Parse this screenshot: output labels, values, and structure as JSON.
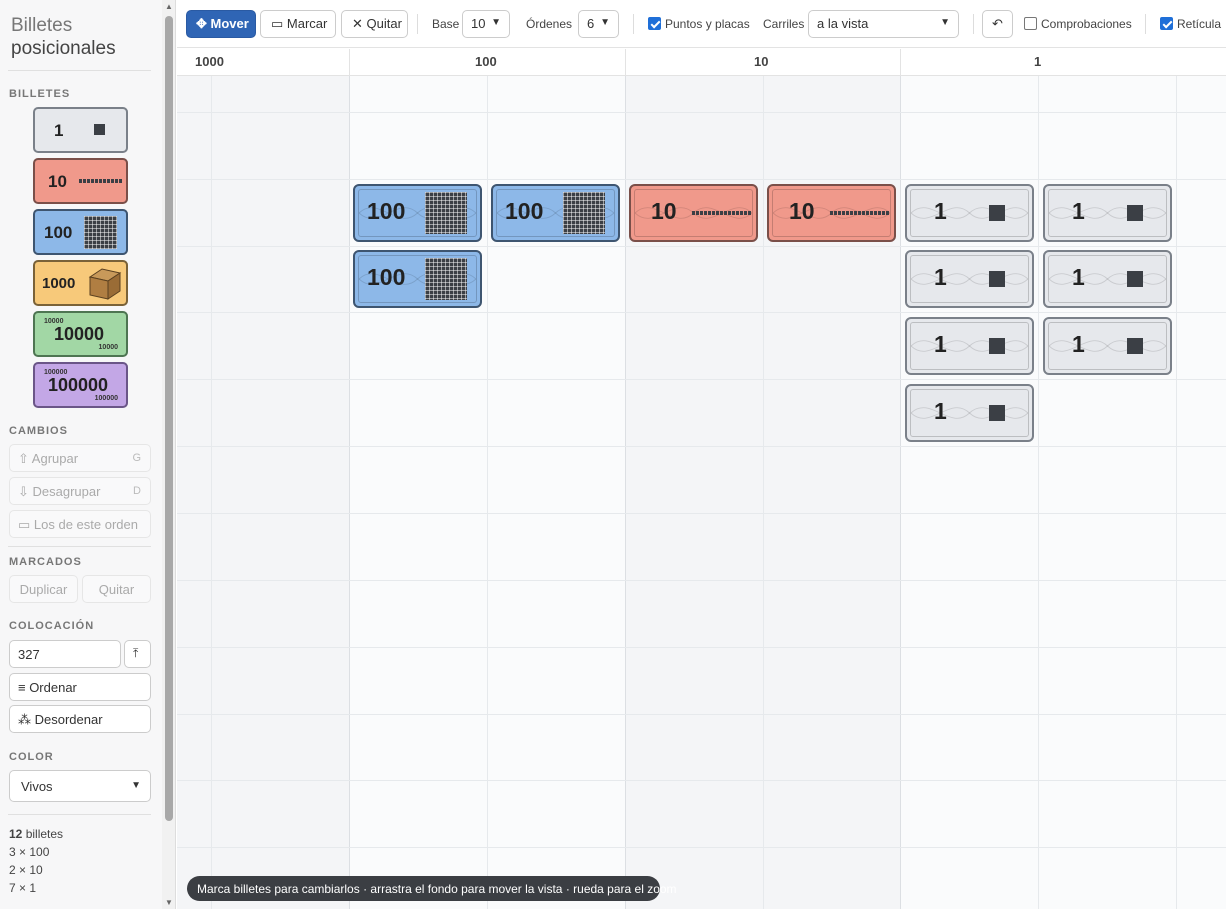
{
  "sidebar": {
    "title_line1": "Billetes",
    "title_line2": "posicionales",
    "sections": {
      "billetes": "BILLETES",
      "cambios": "CAMBIOS",
      "marcados": "MARCADOS",
      "colocacion": "COLOCACIÓN",
      "color": "COLOR"
    },
    "palette": [
      {
        "label": "1",
        "color": "#e6e8ec"
      },
      {
        "label": "10",
        "color": "#f0998b"
      },
      {
        "label": "100",
        "color": "#8db8e8"
      },
      {
        "label": "1000",
        "color": "#f7c97a"
      },
      {
        "label": "10000",
        "color": "#a2d7a5"
      },
      {
        "label": "100000",
        "color": "#c3a7e6"
      }
    ],
    "cambios": {
      "agrupar": "⇧ Agrupar",
      "agrupar_key": "G",
      "desagrupar": "⇩ Desagrupar",
      "desagrupar_key": "D",
      "orden": "▭ Los de este orden"
    },
    "marcados": {
      "duplicar": "Duplicar",
      "quitar": "Quitar"
    },
    "colocacion": {
      "value": "327",
      "ordenar": "≡ Ordenar",
      "desordenar": "⁂ Desordenar"
    },
    "color": {
      "selected": "Vivos"
    },
    "summary": {
      "count": "12",
      "count_label": " billetes",
      "lines": [
        "3 × 100",
        "2 × 10",
        "7 × 1"
      ]
    }
  },
  "toolbar": {
    "mover": "✥ Mover",
    "marcar": "▭ Marcar",
    "quitar": "✕ Quitar",
    "base_label": "Base",
    "base_value": "10",
    "ordenes_label": "Órdenes",
    "ordenes_value": "6",
    "puntos": "Puntos y placas",
    "carriles_label": "Carriles",
    "carriles_value": "a la vista",
    "undo": "↶",
    "comprobaciones": "Comprobaciones",
    "reticula": "Retícula"
  },
  "columns": [
    "1000",
    "100",
    "10",
    "1"
  ],
  "hint": "Marca billetes para cambiarlos · arrastra el fondo para mover la vista · rueda para el zoom",
  "bills": {
    "hundreds": [
      "100",
      "100",
      "100"
    ],
    "tens": [
      "10",
      "10"
    ],
    "ones": [
      "1",
      "1",
      "1",
      "1",
      "1",
      "1",
      "1"
    ]
  },
  "colors": {
    "accent": "#2f65b5",
    "one": "#e6e8ec",
    "ten": "#f0998b",
    "hundred": "#8db8e8",
    "thousand": "#f7c97a",
    "tenthousand": "#a2d7a5",
    "hundredthousand": "#c3a7e6"
  }
}
